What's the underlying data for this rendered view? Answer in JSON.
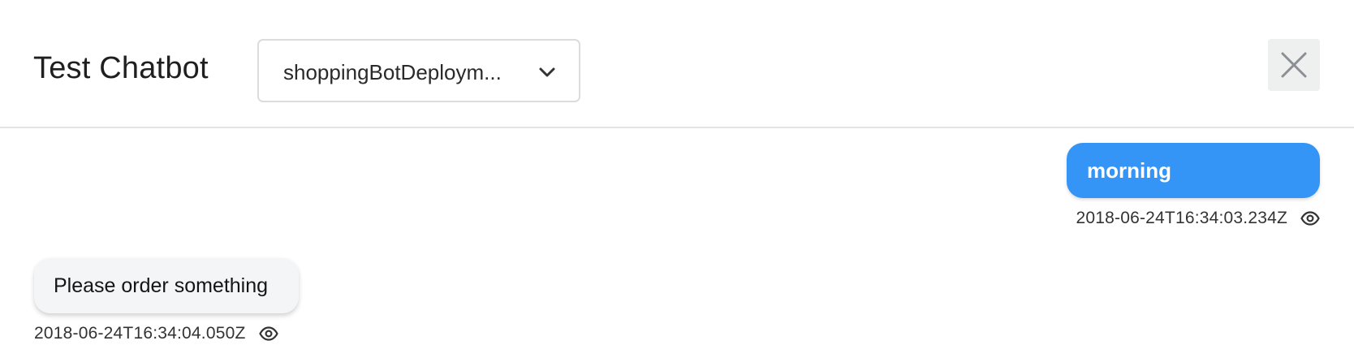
{
  "header": {
    "title": "Test Chatbot",
    "deployment_select": {
      "selected_value": "shoppingBotDeploym...",
      "icon": "chevron-down-icon"
    },
    "close_icon": "close-icon"
  },
  "messages": [
    {
      "sender": "user",
      "text": "morning",
      "timestamp": "2018-06-24T16:34:03.234Z",
      "icon": "eye-icon"
    },
    {
      "sender": "bot",
      "text": "Please order something",
      "timestamp": "2018-06-24T16:34:04.050Z",
      "icon": "eye-icon"
    }
  ],
  "colors": {
    "user_bubble": "#3595f7",
    "bot_bubble": "#f4f5f7",
    "close_button_bg": "#eeefef"
  }
}
